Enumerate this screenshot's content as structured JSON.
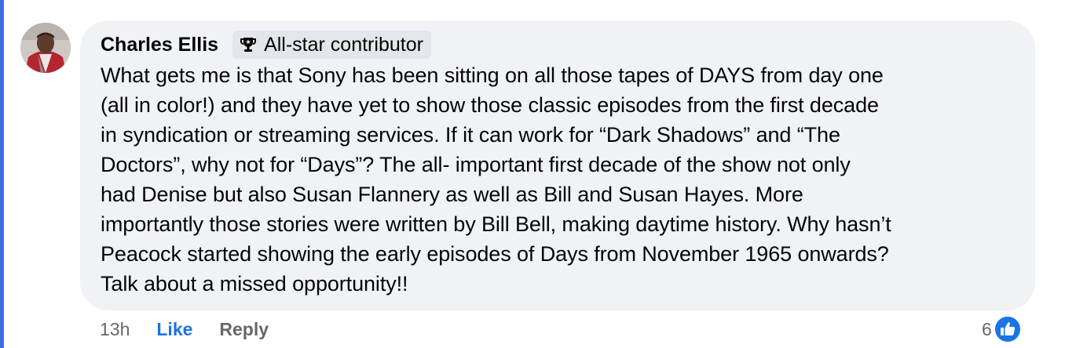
{
  "comment": {
    "author": "Charles Ellis",
    "badge": {
      "icon": "trophy-icon",
      "label": "All-star contributor"
    },
    "lines": [
      "What gets me is that Sony has been sitting on all those tapes of DAYS from day one",
      "(all in color!) and they have yet to show those classic episodes from the first decade",
      "in syndication or streaming services. If it can work for “Dark Shadows” and “The",
      "Doctors”, why not for “Days”? The all- important first decade of the show not only",
      "had Denise but also Susan Flannery as well as Bill and Susan Hayes. More",
      "importantly those stories were written by Bill Bell, making daytime history. Why hasn’t",
      "Peacock started showing the early episodes of Days from November 1965 onwards?",
      "Talk about a missed opportunity!!"
    ],
    "timestamp": "13h",
    "like_label": "Like",
    "reply_label": "Reply",
    "reaction_count": "6",
    "reaction_icon": "thumbs-up-icon"
  },
  "colors": {
    "bubble": "#f0f2f5",
    "accent": "#1b74e4",
    "thread_line": "#3b6fe0",
    "muted": "#65676b"
  }
}
